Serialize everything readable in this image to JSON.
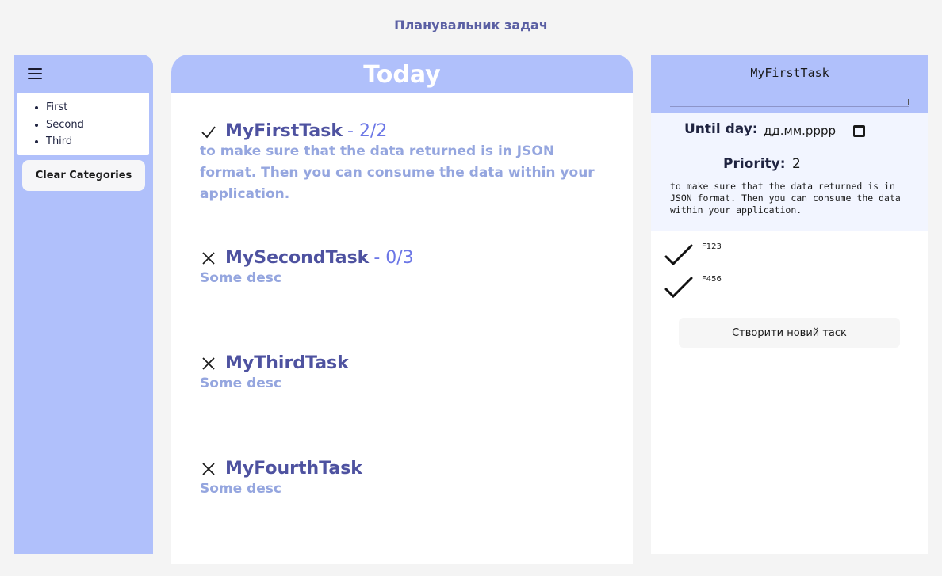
{
  "app": {
    "title": "Планувальник задач"
  },
  "sidebar": {
    "menu_icon": "hamburger-icon",
    "categories": [
      "First",
      "Second",
      "Third"
    ],
    "clear_label": "Clear Categories"
  },
  "main": {
    "header": "Today",
    "tasks": [
      {
        "name": "MyFirstTask",
        "count": "- 2/2",
        "desc": "to make sure that the data returned is in JSON format. Then you can consume the data within your application.",
        "status_icon": "check-icon"
      },
      {
        "name": "MySecondTask",
        "count": "- 0/3",
        "desc": "Some desc",
        "status_icon": "cross-icon"
      },
      {
        "name": "MyThirdTask",
        "count": "",
        "desc": "Some desc",
        "status_icon": "cross-icon"
      },
      {
        "name": "MyFourthTask",
        "count": "",
        "desc": "Some desc",
        "status_icon": "cross-icon"
      }
    ]
  },
  "detail": {
    "name": "MyFirstTask",
    "until_label": "Until day:",
    "date_placeholder": "дд.мм.рррр",
    "priority_label": "Priority:",
    "priority_value": "2",
    "desc": "to make sure that the data returned is in JSON format. Then you can consume the data within your application.",
    "subtasks": [
      {
        "label": "F123",
        "done": true
      },
      {
        "label": "F456",
        "done": true
      }
    ],
    "create_label": "Створити новий таск"
  },
  "colors": {
    "accent": "#b0c0fb",
    "title": "#4e52a0",
    "count": "#6b76e6",
    "desc": "#95a6df"
  }
}
